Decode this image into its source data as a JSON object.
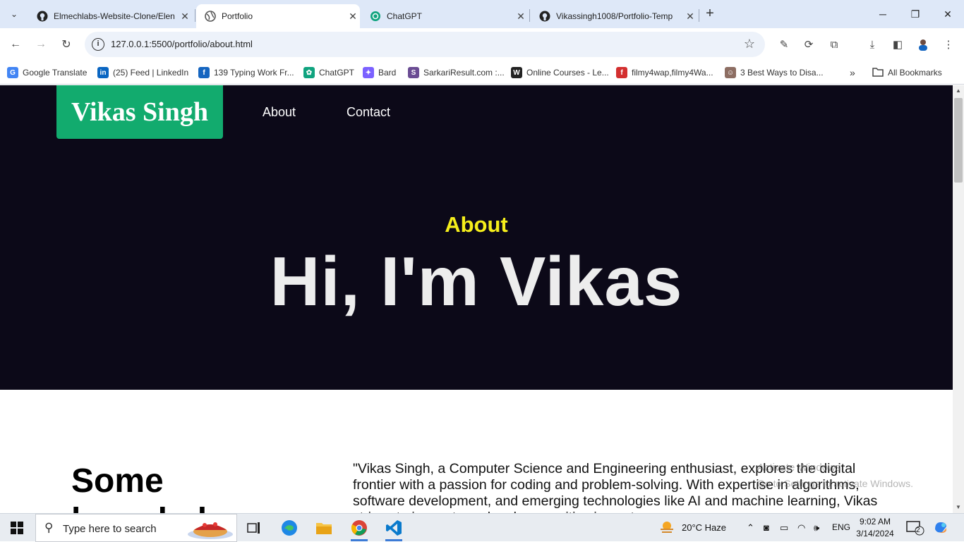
{
  "browser": {
    "tabs": [
      {
        "title": "Elmechlabs-Website-Clone/Elen",
        "icon": "github-icon",
        "active": false
      },
      {
        "title": "Portfolio",
        "icon": "globe-icon",
        "active": true
      },
      {
        "title": "ChatGPT",
        "icon": "chatgpt-icon",
        "active": false
      },
      {
        "title": "Vikassingh1008/Portfolio-Temp",
        "icon": "github-icon",
        "active": false
      }
    ],
    "url": "127.0.0.1:5500/portfolio/about.html",
    "bookmarks": [
      {
        "label": "Google Translate",
        "color": "#4285f4",
        "glyph": "G"
      },
      {
        "label": "(25) Feed | LinkedIn",
        "color": "#0a66c2",
        "glyph": "in"
      },
      {
        "label": "139 Typing Work Fr...",
        "color": "#1565c0",
        "glyph": "f"
      },
      {
        "label": "ChatGPT",
        "color": "#10a37f",
        "glyph": "✿"
      },
      {
        "label": "Bard",
        "color": "#7b61ff",
        "glyph": "✦"
      },
      {
        "label": "SarkariResult.com :...",
        "color": "#6a4c93",
        "glyph": "S"
      },
      {
        "label": "Online Courses - Le...",
        "color": "#222222",
        "glyph": "W"
      },
      {
        "label": "filmy4wap,filmy4Wa...",
        "color": "#d32f2f",
        "glyph": "f"
      },
      {
        "label": "3 Best Ways to Disa...",
        "color": "#8d6e63",
        "glyph": "☺"
      }
    ],
    "all_bookmarks": "All Bookmarks"
  },
  "page": {
    "logo": "Vikas Singh",
    "nav": {
      "about": "About",
      "contact": "Contact"
    },
    "kicker": "About",
    "headline": "Hi, I'm Vikas",
    "section_title": "Some knowledge",
    "section_text": "\"Vikas Singh, a Computer Science and Engineering enthusiast, explores the digital frontier with a passion for coding and problem-solving. With expertise in algorithms, software development, and emerging technologies like AI and machine learning, Vikas strives to innovate and make a positive impact.",
    "colors": {
      "hero_bg": "#0c0918",
      "logo_bg": "#12ab6e",
      "kicker": "#f5ee1b"
    }
  },
  "watermark": {
    "line1": "Activate Windows",
    "line2": "Go to Settings to activate Windows."
  },
  "taskbar": {
    "search_placeholder": "Type here to search",
    "weather": "20°C  Haze",
    "language": "ENG",
    "time": "9:02 AM",
    "date": "3/14/2024",
    "notifications": "2"
  }
}
